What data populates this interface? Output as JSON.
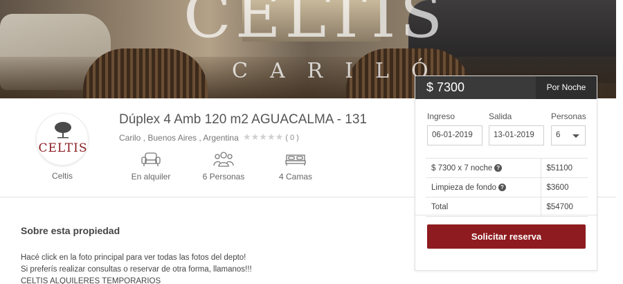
{
  "hero": {
    "brand_big": "CELTIS",
    "brand_sub": "CARILÓ"
  },
  "host": {
    "logo_text": "CELTIS",
    "name": "Celtis"
  },
  "property": {
    "title": "Dúplex 4 Amb 120 m2 AGUACALMA - 131",
    "location": "Carilo , Buenos Aires , Argentina",
    "rating_stars": "★★★★★",
    "rating_count": "( 0 )",
    "features": [
      {
        "icon": "sofa-icon",
        "label": "En alquiler"
      },
      {
        "icon": "people-icon",
        "label": "6 Personas"
      },
      {
        "icon": "bed-icon",
        "label": "4 Camas"
      }
    ]
  },
  "about": {
    "title": "Sobre esta propiedad",
    "lines": [
      "Hacé click en la foto principal para ver todas las fotos del depto!",
      "Si preferís realizar consultas o reservar de otra forma, llamanos!!!",
      "CELTIS ALQUILERES TEMPORARIOS"
    ]
  },
  "booking": {
    "price": "$ 7300",
    "price_unit": "Por Noche",
    "checkin_label": "Ingreso",
    "checkout_label": "Salida",
    "guests_label": "Personas",
    "checkin_value": "06-01-2019",
    "checkout_value": "13-01-2019",
    "guests_value": "6",
    "rows": [
      {
        "label": "$ 7300 x 7 noche",
        "value": "$51100",
        "help": true
      },
      {
        "label": "Limpieza de fondo",
        "value": "$3600",
        "help": true
      },
      {
        "label": "Total",
        "value": "$54700",
        "help": false
      }
    ],
    "cta": "Solicitar reserva"
  },
  "colors": {
    "accent": "#8e1b1f",
    "price_bar": "#3a3a3a"
  }
}
